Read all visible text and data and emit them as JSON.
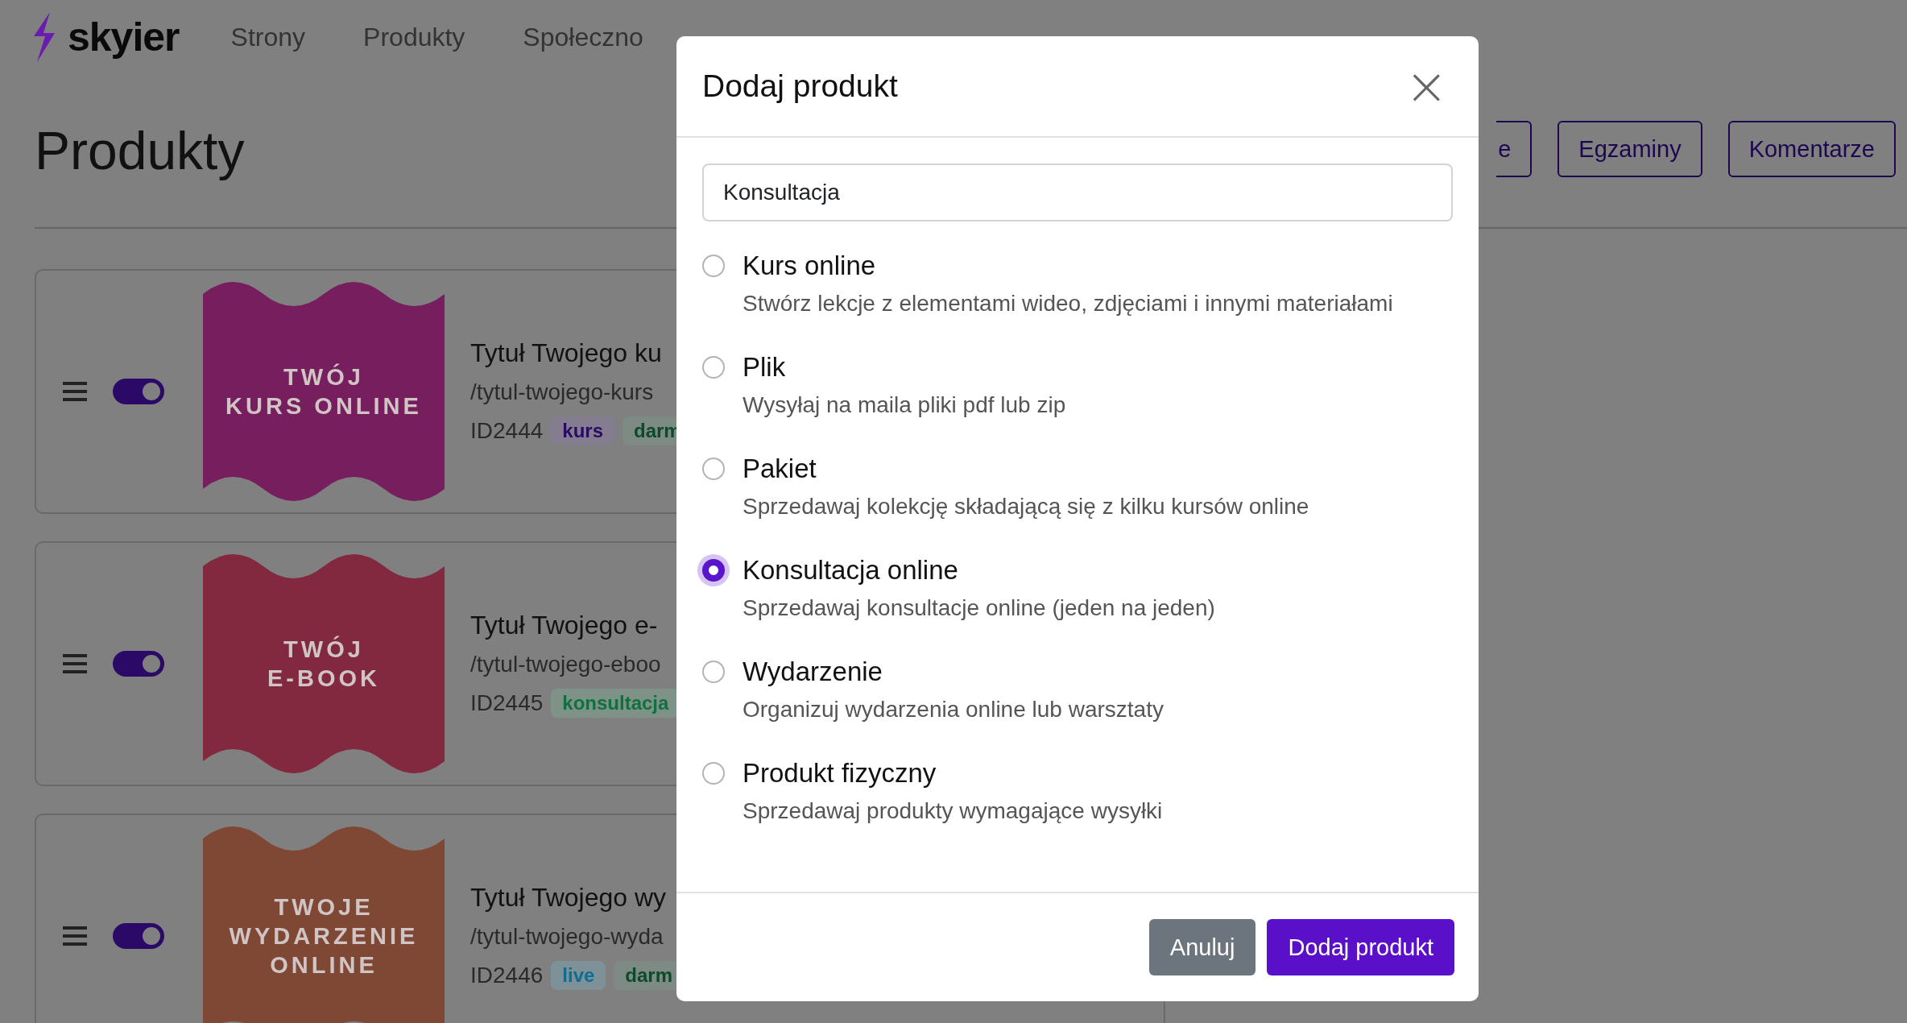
{
  "nav": {
    "logo": "skyier",
    "items": [
      "Strony",
      "Produkty",
      "Społeczno"
    ]
  },
  "page": {
    "title": "Produkty",
    "buttons": [
      "e",
      "Egzaminy",
      "Komentarze"
    ]
  },
  "products": [
    {
      "on": true,
      "color": "#761e5e",
      "cover_text": "TWÓJ\nKURS ONLINE",
      "title": "Tytuł Twojego ku",
      "slug": "/tytul-twojego-kurs",
      "id": "ID2444",
      "tags": [
        {
          "label": "kurs",
          "color": "#2a0a66"
        },
        {
          "label": "darm",
          "color": "#0c4a2a"
        }
      ]
    },
    {
      "on": true,
      "color": "#82283f",
      "cover_text": "TWÓJ\nE-BOOK",
      "title": "Tytuł Twojego e-",
      "slug": "/tytul-twojego-eboo",
      "id": "ID2445",
      "tags": [
        {
          "label": "konsultacja",
          "color": "#107040"
        }
      ]
    },
    {
      "on": true,
      "color": "#7f4834",
      "cover_text": "TWOJE\nWYDARZENIE\nONLINE",
      "title": "Tytuł Twojego wy",
      "slug": "/tytul-twojego-wyda",
      "id": "ID2446",
      "tags": [
        {
          "label": "live",
          "color": "#0e6e92"
        },
        {
          "label": "darm",
          "color": "#0c4a2a"
        }
      ]
    }
  ],
  "modal": {
    "title": "Dodaj produkt",
    "close": "×",
    "field": {
      "value": "Konsultacja"
    },
    "options": [
      {
        "label": "Kurs online",
        "description": "Stwórz lekcje z elementami wideo, zdjęciami i innymi materiałami",
        "selected": false
      },
      {
        "label": "Plik",
        "description": "Wysyłaj na maila pliki pdf lub zip",
        "selected": false
      },
      {
        "label": "Pakiet",
        "description": "Sprzedawaj kolekcję składającą się z kilku kursów online",
        "selected": false
      },
      {
        "label": "Konsultacja online",
        "description": "Sprzedawaj konsultacje online (jeden na jeden)",
        "selected": true
      },
      {
        "label": "Wydarzenie",
        "description": "Organizuj wydarzenia online lub warsztaty",
        "selected": false
      },
      {
        "label": "Produkt fizyczny",
        "description": "Sprzedawaj produkty wymagające wysyłki",
        "selected": false
      }
    ],
    "buttons": [
      {
        "label": "Anuluj",
        "kind": "secondary"
      },
      {
        "label": "Dodaj produkt",
        "kind": "primary"
      }
    ]
  }
}
